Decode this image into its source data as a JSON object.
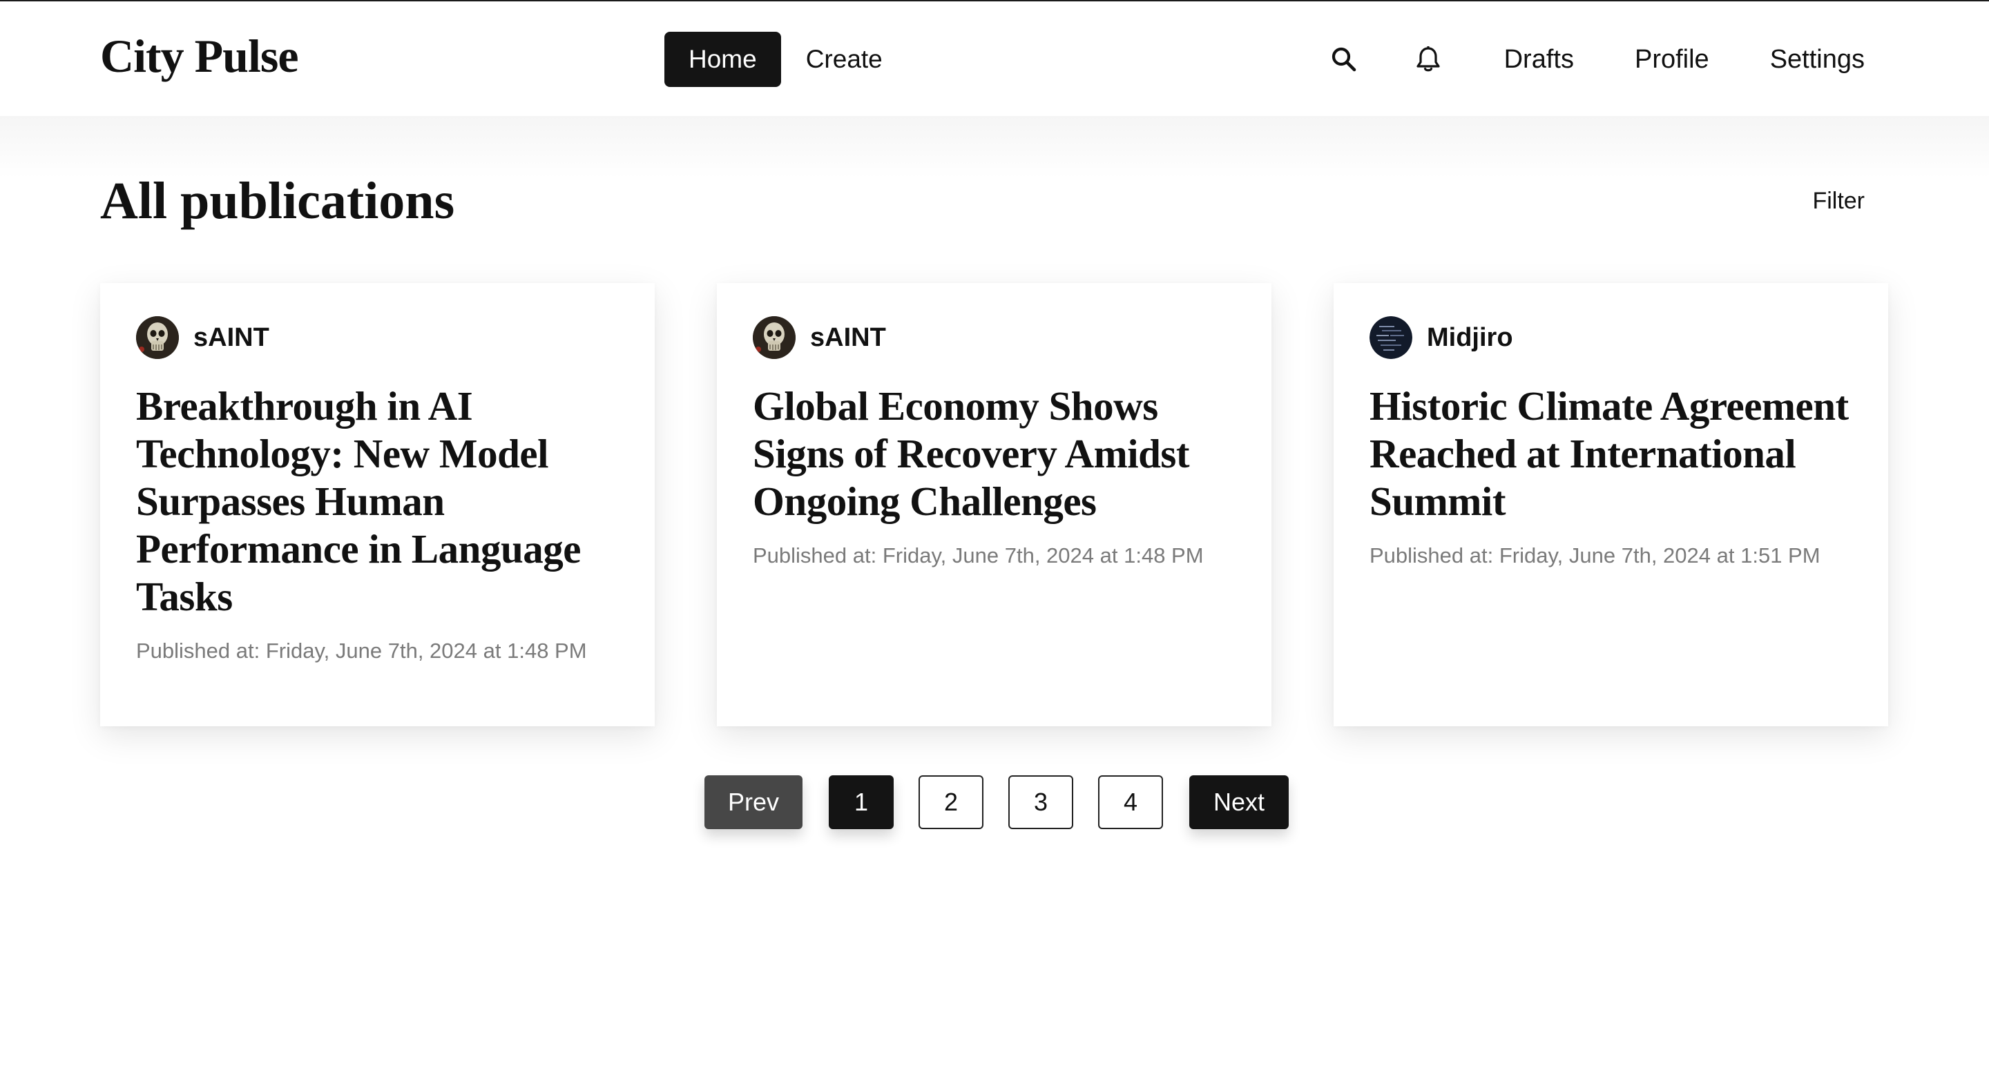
{
  "header": {
    "brand": "City Pulse",
    "nav": [
      {
        "label": "Home",
        "active": true
      },
      {
        "label": "Create",
        "active": false
      }
    ],
    "icons": [
      "search-icon",
      "bell-icon"
    ],
    "links": [
      "Drafts",
      "Profile",
      "Settings"
    ]
  },
  "main": {
    "title": "All publications",
    "filter_label": "Filter",
    "cards": [
      {
        "author": "sAINT",
        "avatar": "skull-avatar",
        "title": "Breakthrough in AI Technology: New Model Surpasses Human Performance in Language Tasks",
        "published": "Published at: Friday, June 7th, 2024 at 1:48 PM"
      },
      {
        "author": "sAINT",
        "avatar": "skull-avatar",
        "title": "Global Economy Shows Signs of Recovery Amidst Ongoing Challenges",
        "published": "Published at: Friday, June 7th, 2024 at 1:48 PM"
      },
      {
        "author": "Midjiro",
        "avatar": "code-avatar",
        "title": "Historic Climate Agreement Reached at International Summit",
        "published": "Published at: Friday, June 7th, 2024 at 1:51 PM"
      }
    ]
  },
  "pagination": {
    "prev_label": "Prev",
    "pages": [
      "1",
      "2",
      "3",
      "4"
    ],
    "current_page": "1",
    "next_label": "Next"
  },
  "colors": {
    "accent_dark": "#141414",
    "prev_button": "#474747",
    "meta_text": "#7a7a7a"
  }
}
